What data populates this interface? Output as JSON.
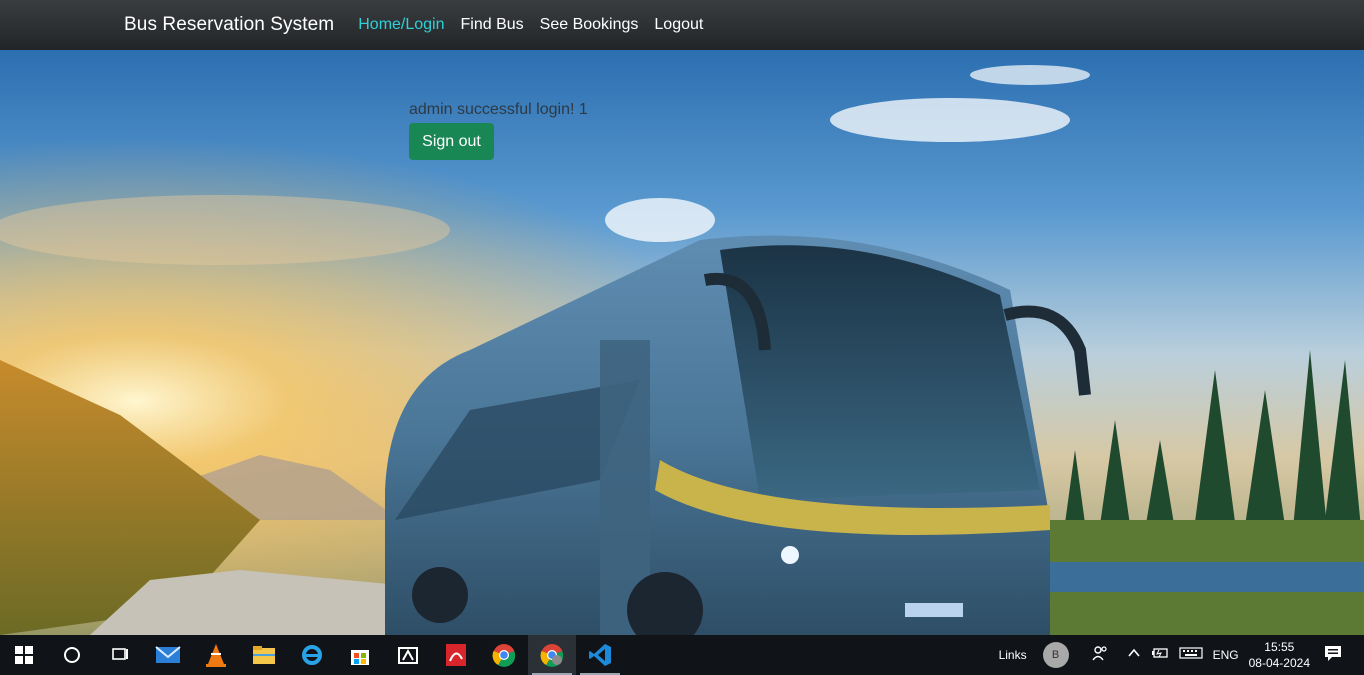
{
  "navbar": {
    "brand": "Bus Reservation System",
    "links": [
      "Home/Login",
      "Find Bus",
      "See Bookings",
      "Logout"
    ]
  },
  "main": {
    "message": "admin successful login! 1",
    "signout_label": "Sign out"
  },
  "colors": {
    "nav_active": "#2ed0d7",
    "signout_button": "#198754",
    "navbar_bg": "#2b2e31"
  },
  "taskbar": {
    "icons": [
      "windows-start-icon",
      "cortana-search-icon",
      "task-view-icon",
      "mail-icon",
      "vlc-icon",
      "file-explorer-icon",
      "internet-explorer-icon",
      "store-icon",
      "media-icon",
      "pdf-reader-icon",
      "chrome-icon",
      "chrome-profile-icon",
      "vscode-icon"
    ],
    "links_label": "Links",
    "avatar_letter": "B",
    "language": "ENG",
    "time": "15:55",
    "date": "08-04-2024"
  }
}
